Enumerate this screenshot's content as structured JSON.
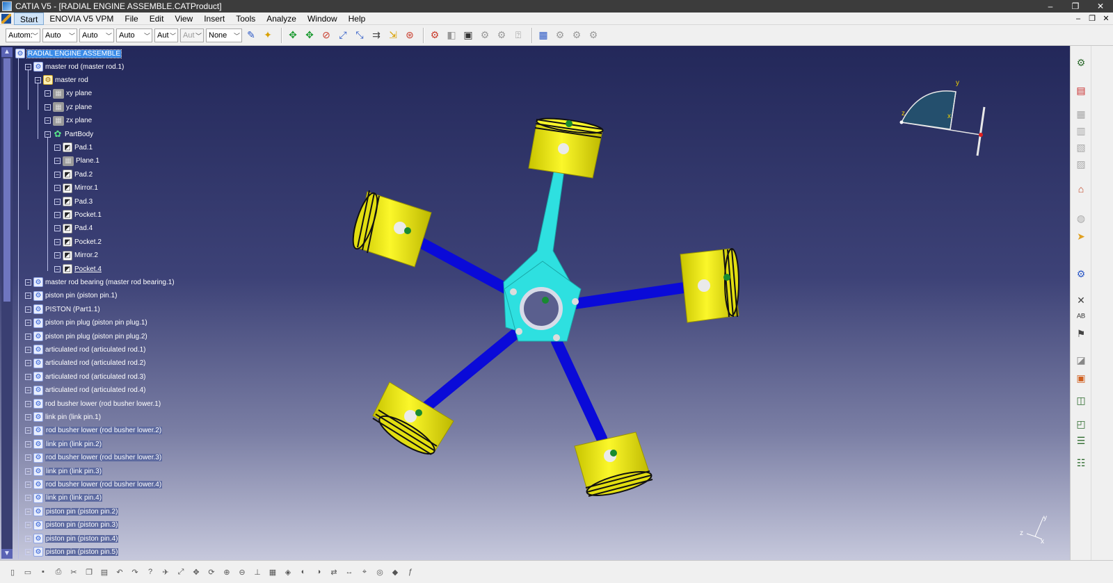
{
  "window": {
    "title": "CATIA V5 - [RADIAL ENGINE ASSEMBLE.CATProduct]",
    "minimize": "–",
    "maximize": "❐",
    "close": "✕"
  },
  "menu": {
    "items": [
      "Start",
      "ENOVIA V5 VPM",
      "File",
      "Edit",
      "View",
      "Insert",
      "Tools",
      "Analyze",
      "Window",
      "Help"
    ],
    "doc_minimize": "–",
    "doc_restore": "❐",
    "doc_close": "✕"
  },
  "toolbar": {
    "selects": [
      "Autom:",
      "Auto",
      "Auto",
      "Auto",
      "Aut",
      "Aut",
      "None"
    ],
    "icons": [
      "brush-icon",
      "paint-icon",
      "move-icon",
      "manipulate-icon",
      "snap-icon",
      "explode-icon",
      "stop-icon",
      "clash-icon",
      "distance-icon",
      "sectioning-icon",
      "catalog-icon",
      "constraint-icon",
      "coincidence-icon",
      "offset-icon",
      "angle-icon",
      "fix-icon",
      "reuse-icon",
      "save-management-icon",
      "measure-icon"
    ]
  },
  "tree": {
    "root": "RADIAL ENGINE ASSEMBLE",
    "nodes": [
      {
        "label": "master rod (master rod.1)",
        "type": "product",
        "depth": 1
      },
      {
        "label": "master rod",
        "type": "part",
        "depth": 2
      },
      {
        "label": "xy plane",
        "type": "plane",
        "depth": 3
      },
      {
        "label": "yz plane",
        "type": "plane",
        "depth": 3
      },
      {
        "label": "zx plane",
        "type": "plane",
        "depth": 3
      },
      {
        "label": "PartBody",
        "type": "body",
        "depth": 3
      },
      {
        "label": "Pad.1",
        "type": "feature",
        "depth": 4
      },
      {
        "label": "Plane.1",
        "type": "plane",
        "depth": 4
      },
      {
        "label": "Pad.2",
        "type": "feature",
        "depth": 4
      },
      {
        "label": "Mirror.1",
        "type": "feature",
        "depth": 4
      },
      {
        "label": "Pad.3",
        "type": "feature",
        "depth": 4
      },
      {
        "label": "Pocket.1",
        "type": "feature",
        "depth": 4
      },
      {
        "label": "Pad.4",
        "type": "feature",
        "depth": 4
      },
      {
        "label": "Pocket.2",
        "type": "feature",
        "depth": 4
      },
      {
        "label": "Mirror.2",
        "type": "feature",
        "depth": 4
      },
      {
        "label": "Pocket.4",
        "type": "feature",
        "depth": 4,
        "underline": true
      },
      {
        "label": "master rod bearing (master rod bearing.1)",
        "type": "product",
        "depth": 1
      },
      {
        "label": "piston pin (piston pin.1)",
        "type": "product",
        "depth": 1
      },
      {
        "label": "PISTON (Part1.1)",
        "type": "product",
        "depth": 1
      },
      {
        "label": "piston pin plug (piston pin plug.1)",
        "type": "product",
        "depth": 1
      },
      {
        "label": "piston pin plug (piston pin plug.2)",
        "type": "product",
        "depth": 1
      },
      {
        "label": "articulated rod (articulated rod.1)",
        "type": "product",
        "depth": 1
      },
      {
        "label": "articulated rod (articulated rod.2)",
        "type": "product",
        "depth": 1
      },
      {
        "label": "articulated rod (articulated rod.3)",
        "type": "product",
        "depth": 1
      },
      {
        "label": "articulated rod (articulated rod.4)",
        "type": "product",
        "depth": 1
      },
      {
        "label": "rod busher lower (rod busher lower.1)",
        "type": "product",
        "depth": 1
      },
      {
        "label": "link pin (link pin.1)",
        "type": "product",
        "depth": 1
      },
      {
        "label": "rod busher lower (rod busher lower.2)",
        "type": "product",
        "depth": 1,
        "highlight": true
      },
      {
        "label": "link pin (link pin.2)",
        "type": "product",
        "depth": 1,
        "highlight": true
      },
      {
        "label": "rod busher lower (rod busher lower.3)",
        "type": "product",
        "depth": 1,
        "highlight": true
      },
      {
        "label": "link pin (link pin.3)",
        "type": "product",
        "depth": 1,
        "highlight": true
      },
      {
        "label": "rod busher lower (rod busher lower.4)",
        "type": "product",
        "depth": 1,
        "highlight": true
      },
      {
        "label": "link pin (link pin.4)",
        "type": "product",
        "depth": 1,
        "highlight": true
      },
      {
        "label": "piston pin (piston pin.2)",
        "type": "product",
        "depth": 1,
        "highlight": true
      },
      {
        "label": "piston pin (piston pin.3)",
        "type": "product",
        "depth": 1,
        "highlight": true
      },
      {
        "label": "piston pin (piston pin.4)",
        "type": "product",
        "depth": 1,
        "highlight": true
      },
      {
        "label": "piston pin (piston pin.5)",
        "type": "product",
        "depth": 1,
        "highlight": true
      }
    ]
  },
  "compass": {
    "x": "x",
    "y": "y",
    "z": "z"
  },
  "axis": {
    "x": "x",
    "y": "y",
    "z": "z"
  },
  "colors": {
    "viewport_top": "#23285a",
    "viewport_bottom": "#c6c8dc",
    "piston": "#f4f01a",
    "rod": "#0a0ad8",
    "master_rod": "#2ee0e0",
    "selection": "#3a8be8"
  },
  "right_toolbar": {
    "icons": [
      "fly-mode-icon",
      "pdf-icon",
      "annotation-icon",
      "view-icon",
      "section-icon",
      "sheet-icon",
      "measure-icon",
      "hide-icon",
      "cursor-icon",
      "gear-icon",
      "snap-icon",
      "text-icon",
      "flag-icon",
      "box-icon",
      "catalog-icon",
      "cube-icon",
      "cubes-icon",
      "list-icon",
      "list2-icon"
    ]
  }
}
